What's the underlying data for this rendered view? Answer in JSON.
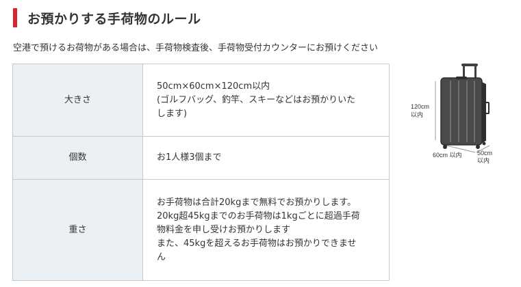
{
  "section": {
    "title": "お預かりする手荷物のルール",
    "intro": "空港で預けるお荷物がある場合は、手荷物検査後、手荷物受付カウンターにお預けください"
  },
  "rules": [
    {
      "label": "大きさ",
      "lines": [
        "50cm×60cm×120cm以内",
        "(ゴルフバッグ、釣竿、スキーなどはお預かりいた",
        "します)"
      ]
    },
    {
      "label": "個数",
      "lines": [
        "お1人様3個まで"
      ]
    },
    {
      "label": "重さ",
      "lines": [
        "お手荷物は合計20kgまで無料でお預かりします。",
        "20kg超45kgまでのお手荷物は1kgごとに超過手荷",
        "物料金を申し受けお預かりします",
        "また、45kgを超えるお手荷物はお預かりできませ",
        "ん"
      ]
    }
  ],
  "illustration": {
    "icon": "suitcase-icon",
    "height_label_1": "120cm",
    "height_label_2": "以内",
    "width_label": "60cm 以内",
    "depth_label_1": "50cm",
    "depth_label_2": "以内"
  },
  "colors": {
    "accent": "#d9232d",
    "label_bg": "#eaf0f4",
    "border": "#c8c8c8",
    "text": "#333333"
  }
}
